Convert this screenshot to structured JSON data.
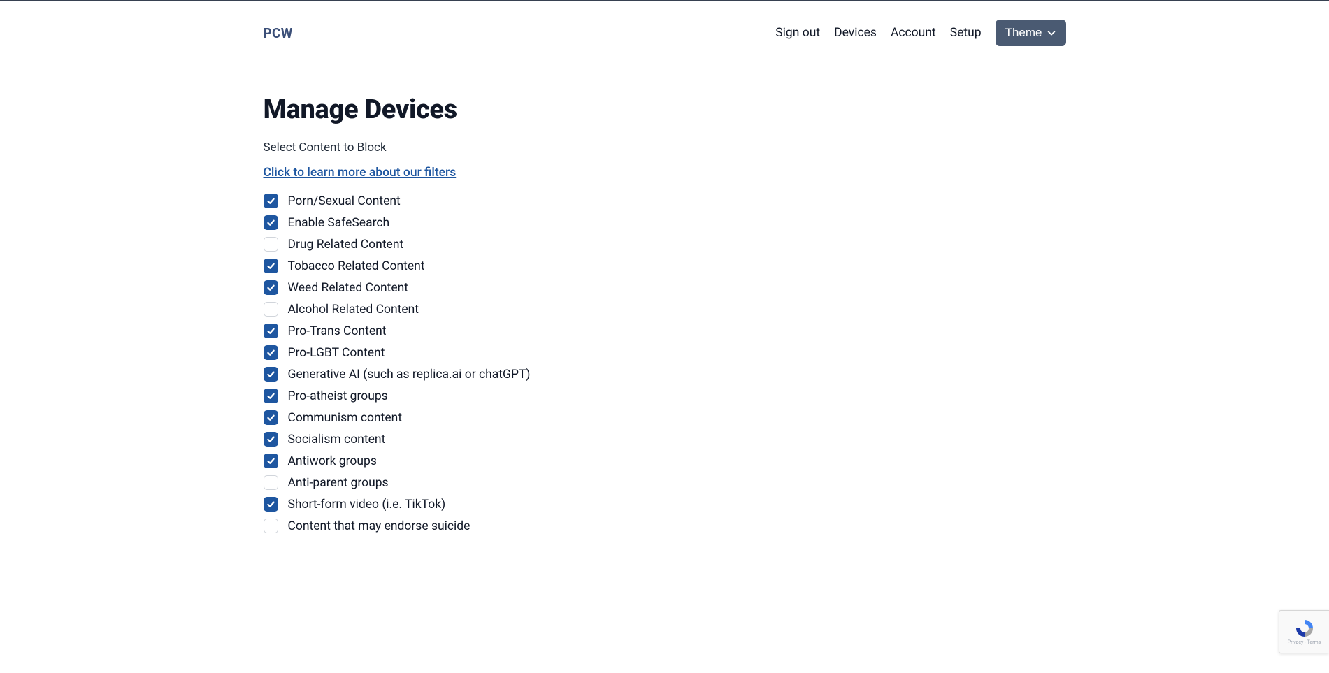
{
  "brand": "PCW",
  "nav": {
    "signout": "Sign out",
    "devices": "Devices",
    "account": "Account",
    "setup": "Setup",
    "theme": "Theme"
  },
  "page": {
    "title": "Manage Devices",
    "subtitle": "Select Content to Block",
    "learn_link": "Click to learn more about our filters"
  },
  "filters": [
    {
      "label": "Porn/Sexual Content",
      "checked": true
    },
    {
      "label": "Enable SafeSearch",
      "checked": true
    },
    {
      "label": "Drug Related Content",
      "checked": false
    },
    {
      "label": "Tobacco Related Content",
      "checked": true
    },
    {
      "label": "Weed Related Content",
      "checked": true
    },
    {
      "label": "Alcohol Related Content",
      "checked": false
    },
    {
      "label": "Pro-Trans Content",
      "checked": true
    },
    {
      "label": "Pro-LGBT Content",
      "checked": true
    },
    {
      "label": "Generative AI (such as replica.ai or chatGPT)",
      "checked": true
    },
    {
      "label": "Pro-atheist groups",
      "checked": true
    },
    {
      "label": "Communism content",
      "checked": true
    },
    {
      "label": "Socialism content",
      "checked": true
    },
    {
      "label": "Antiwork groups",
      "checked": true
    },
    {
      "label": "Anti-parent groups",
      "checked": false
    },
    {
      "label": "Short-form video (i.e. TikTok)",
      "checked": true
    },
    {
      "label": "Content that may endorse suicide",
      "checked": false
    }
  ],
  "recaptcha": {
    "privacy": "Privacy",
    "terms": "Terms"
  }
}
